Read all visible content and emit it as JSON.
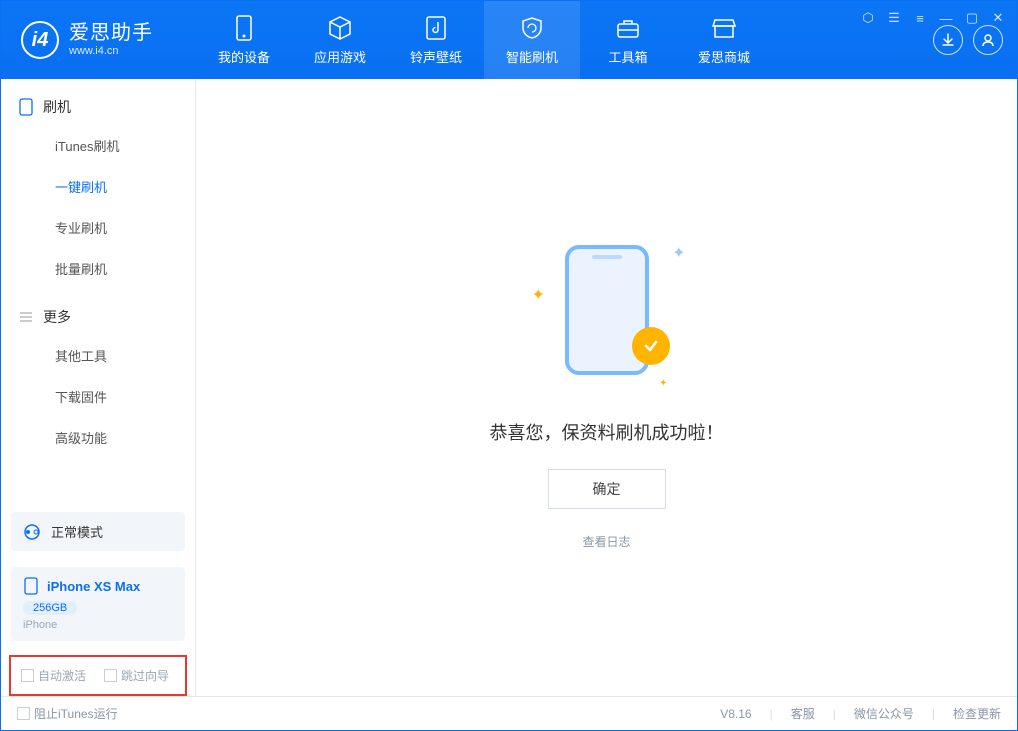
{
  "app": {
    "title": "爱思助手",
    "subtitle": "www.i4.cn",
    "version": "V8.16"
  },
  "header_tabs": [
    {
      "label": "我的设备"
    },
    {
      "label": "应用游戏"
    },
    {
      "label": "铃声壁纸"
    },
    {
      "label": "智能刷机"
    },
    {
      "label": "工具箱"
    },
    {
      "label": "爱思商城"
    }
  ],
  "sidebar": {
    "section1_title": "刷机",
    "section1_items": [
      {
        "label": "iTunes刷机"
      },
      {
        "label": "一键刷机"
      },
      {
        "label": "专业刷机"
      },
      {
        "label": "批量刷机"
      }
    ],
    "section2_title": "更多",
    "section2_items": [
      {
        "label": "其他工具"
      },
      {
        "label": "下载固件"
      },
      {
        "label": "高级功能"
      }
    ],
    "mode_label": "正常模式",
    "device": {
      "name": "iPhone XS Max",
      "capacity": "256GB",
      "type": "iPhone"
    },
    "opt_auto_activate": "自动激活",
    "opt_skip_guide": "跳过向导"
  },
  "main": {
    "success_msg": "恭喜您，保资料刷机成功啦！",
    "ok_button": "确定",
    "view_log": "查看日志"
  },
  "footer": {
    "block_itunes": "阻止iTunes运行",
    "links": [
      {
        "label": "客服"
      },
      {
        "label": "微信公众号"
      },
      {
        "label": "检查更新"
      }
    ]
  }
}
